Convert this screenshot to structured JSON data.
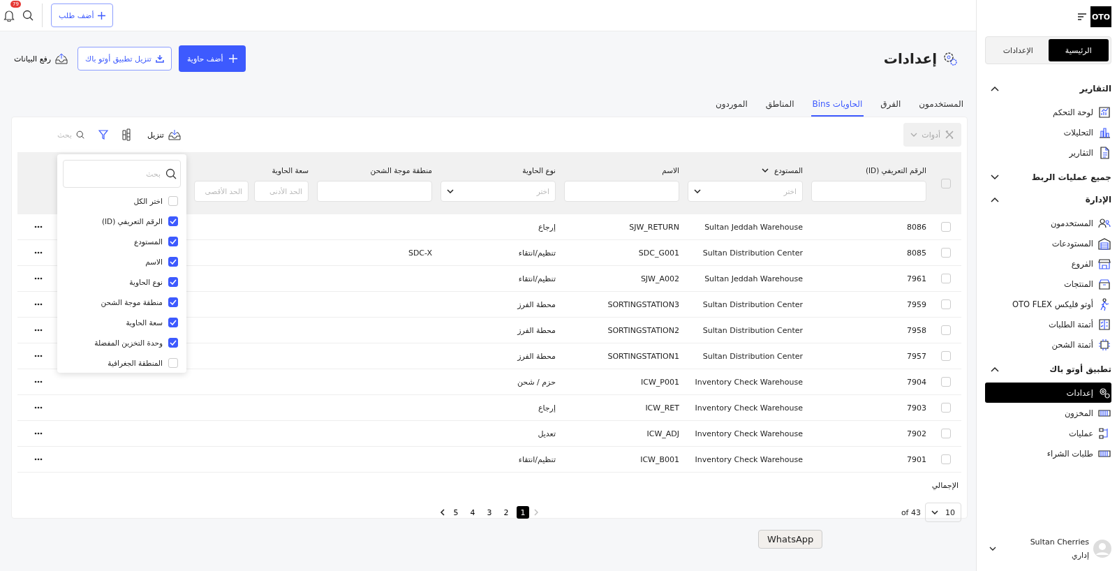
{
  "topbar": {
    "add_order": "أضف طلب",
    "notifications_badge": "79"
  },
  "header": {
    "title": "إعدادات",
    "upload": "رفع البيانات",
    "download_app": "تنزيل تطبيق أوتو باك",
    "add_bin": "أضف حاوية"
  },
  "tabs": [
    {
      "label": "المستخدمون",
      "selected": false
    },
    {
      "label": "الفرق",
      "selected": false
    },
    {
      "label": "الحاويات Bins",
      "selected": true
    },
    {
      "label": "المناطق",
      "selected": false
    },
    {
      "label": "الموردون",
      "selected": false
    }
  ],
  "toolbar": {
    "tools": {
      "label": "أدوات",
      "disabled": true
    },
    "search": {
      "placeholder": "بحث"
    },
    "download": "تنزيل"
  },
  "table": {
    "select_all_checked": false,
    "columns": [
      {
        "label": "الرقم التعريفي (ID)",
        "kind": "text",
        "sort_menu": false
      },
      {
        "label": "المستودع",
        "kind": "select",
        "placeholder": "اختر",
        "sort_menu": true
      },
      {
        "label": "الاسم",
        "kind": "text",
        "sort_menu": false
      },
      {
        "label": "نوع الحاوية",
        "kind": "select",
        "placeholder": "اختر",
        "sort_menu": false
      },
      {
        "label": "منطقة موجة الشحن",
        "kind": "text",
        "sort_menu": false
      },
      {
        "label": "سعة الحاوية",
        "kind": "range",
        "min_placeholder": "الحد الأدنى",
        "max_placeholder": "الحد الأقصى",
        "sort_menu": false
      }
    ],
    "rows": [
      {
        "checked": false,
        "id": "8086",
        "warehouse": "Sultan Jeddah Warehouse",
        "name": "SJW_RETURN",
        "type": "إرجاع"
      },
      {
        "checked": false,
        "id": "8085",
        "warehouse": "Sultan Distribution Center",
        "name": "SDC_G001",
        "type": "تنظيم/انتقاء",
        "zone": "SDC-X"
      },
      {
        "checked": false,
        "id": "7961",
        "warehouse": "Sultan Jeddah Warehouse",
        "name": "SJW_A002",
        "type": "تنظيم/انتقاء"
      },
      {
        "checked": false,
        "id": "7959",
        "warehouse": "Sultan Distribution Center",
        "name": "SORTINGSTATION3",
        "type": "محطة الفرز"
      },
      {
        "checked": false,
        "id": "7958",
        "warehouse": "Sultan Distribution Center",
        "name": "SORTINGSTATION2",
        "type": "محطة الفرز"
      },
      {
        "checked": false,
        "id": "7957",
        "warehouse": "Sultan Distribution Center",
        "name": "SORTINGSTATION1",
        "type": "محطة الفرز"
      },
      {
        "checked": false,
        "id": "7904",
        "warehouse": "Inventory Check Warehouse",
        "name": "ICW_P001",
        "type": "حزم / شحن"
      },
      {
        "checked": false,
        "id": "7903",
        "warehouse": "Inventory Check Warehouse",
        "name": "ICW_RET",
        "type": "إرجاع"
      },
      {
        "checked": false,
        "id": "7902",
        "warehouse": "Inventory Check Warehouse",
        "name": "ICW_ADJ",
        "type": "تعديل"
      },
      {
        "checked": false,
        "id": "7901",
        "warehouse": "Inventory Check Warehouse",
        "name": "ICW_B001",
        "type": "تنظيم/انتقاء"
      }
    ]
  },
  "column_picker": {
    "search_placeholder": "بحث",
    "items": [
      {
        "label": "اختر الكل",
        "checked": false
      },
      {
        "label": "الرقم التعريفي (ID)",
        "checked": true
      },
      {
        "label": "المستودع",
        "checked": true
      },
      {
        "label": "الاسم",
        "checked": true
      },
      {
        "label": "نوع الحاوية",
        "checked": true
      },
      {
        "label": "منطقة موجة الشحن",
        "checked": true
      },
      {
        "label": "سعة الحاوية",
        "checked": true
      },
      {
        "label": "وحدة التخزين المفضلة",
        "checked": true
      },
      {
        "label": "المنطقة الجغرافية",
        "checked": false
      }
    ]
  },
  "footer": {
    "total_label": "الإجمالي",
    "per_page": "10",
    "total": "43 of",
    "pages": [
      {
        "label": "1",
        "selected": true
      },
      {
        "label": "2",
        "selected": false
      },
      {
        "label": "3",
        "selected": false
      },
      {
        "label": "4",
        "selected": false
      },
      {
        "label": "5",
        "selected": false
      }
    ]
  },
  "sidebar": {
    "logo": "OTO",
    "switch": [
      {
        "label": "الرئيسية",
        "selected": true
      },
      {
        "label": "الإعدادات",
        "selected": false
      }
    ],
    "sections": [
      {
        "title": "التقارير",
        "expanded": true,
        "items": [
          {
            "label": "لوحة التحكم",
            "selected": false
          },
          {
            "label": "التحليلات",
            "selected": false
          },
          {
            "label": "التقارير",
            "selected": false
          }
        ]
      },
      {
        "title": "جميع عمليات الربط",
        "expanded": false
      },
      {
        "title": "الإدارة",
        "expanded": true,
        "items": [
          {
            "label": "المستخدمون",
            "selected": false
          },
          {
            "label": "المستودعات",
            "selected": false
          },
          {
            "label": "الفروع",
            "selected": false
          },
          {
            "label": "المنتجات",
            "selected": false
          },
          {
            "label": "أوتو فليكس OTO FLEX",
            "selected": false
          },
          {
            "label": "أتمتة الطلبات",
            "selected": false
          },
          {
            "label": "أتمتة الشحن",
            "selected": false
          }
        ]
      },
      {
        "title": "تطبيق أوتو باك",
        "expanded": true,
        "items": [
          {
            "label": "إعدادات",
            "selected": true
          },
          {
            "label": "المخزون",
            "selected": false
          },
          {
            "label": "عمليات",
            "selected": false
          },
          {
            "label": "طلبات الشراء",
            "selected": false
          }
        ]
      }
    ],
    "user": {
      "name": "Sultan Cherries",
      "role": "إداري"
    }
  },
  "tooltip": "WhatsApp"
}
